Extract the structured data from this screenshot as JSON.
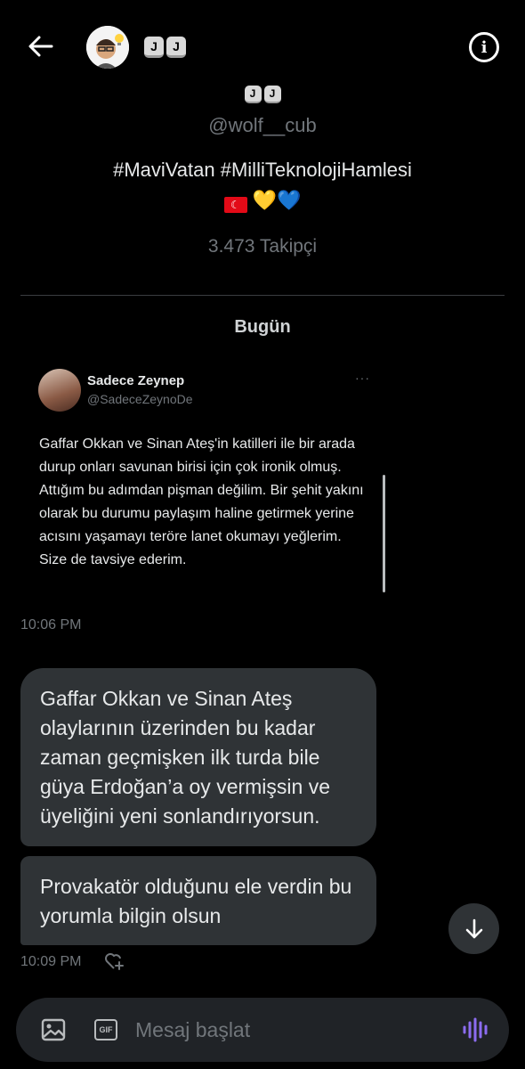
{
  "header": {
    "display_name_keys": [
      "J",
      "J"
    ]
  },
  "profile": {
    "name_keys": [
      "J",
      "J"
    ],
    "handle": "@wolf__cub",
    "bio": "#MaviVatan #MilliTeknolojiHamlesi",
    "emojis": "💛💙",
    "followers": "3.473 Takipçi"
  },
  "day_label": "Bugün",
  "shared_tweet": {
    "author_name": "Sadece Zeynep",
    "author_handle": "@SadeceZeynoDe",
    "more": "···",
    "text": "Gaffar Okkan ve Sinan Ateş'in katilleri ile bir arada durup onları savunan birisi için çok ironik olmuş. Attığım bu adımdan pişman değilim. Bir şehit yakını olarak bu durumu paylaşım haline getirmek yerine acısını yaşamayı teröre lanet okumayı yeğlerim. Size de tavsiye ederim.",
    "time": "10:06 PM"
  },
  "messages": [
    {
      "text": "Gaffar Okkan ve Sinan Ateş olaylarının üzerinden bu kadar zaman geçmişken ilk turda bile güya Erdoğan’a oy vermişsin ve üyeliğini yeni sonlandırıyorsun."
    },
    {
      "text": "Provakatör olduğunu ele verdin bu yorumla bilgin olsun"
    }
  ],
  "last_time": "10:09 PM",
  "composer": {
    "placeholder": "Mesaj başlat",
    "gif_label": "GIF"
  },
  "colors": {
    "background": "#000000",
    "bubble": "#2f3336",
    "secondary_text": "#71767b",
    "voice_accent": "#8c6cf0"
  }
}
